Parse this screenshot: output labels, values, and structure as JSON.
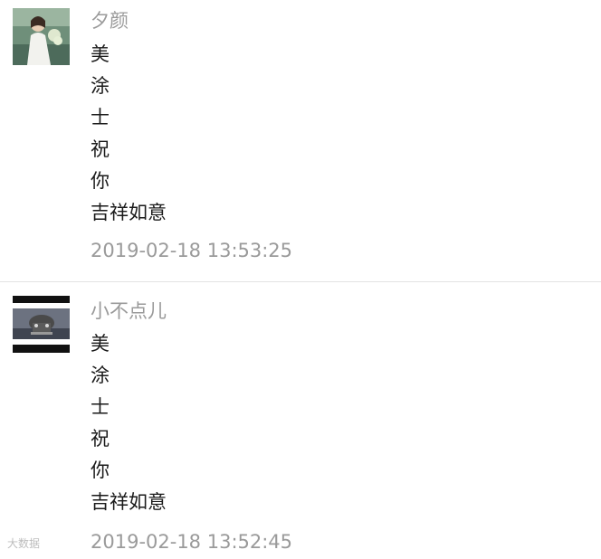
{
  "posts": [
    {
      "avatar": "profile-photo-girl",
      "username": "夕颜",
      "lines": [
        "美",
        "涂",
        "士",
        "祝",
        "你",
        "吉祥如意"
      ],
      "timestamp": "2019-02-18 13:53:25"
    },
    {
      "avatar": "profile-photo-car",
      "username": "小不点儿",
      "lines": [
        "美",
        "涂",
        "士",
        "祝",
        "你",
        "吉祥如意"
      ],
      "timestamp": "2019-02-18 13:52:45"
    }
  ],
  "watermark": "大数据"
}
